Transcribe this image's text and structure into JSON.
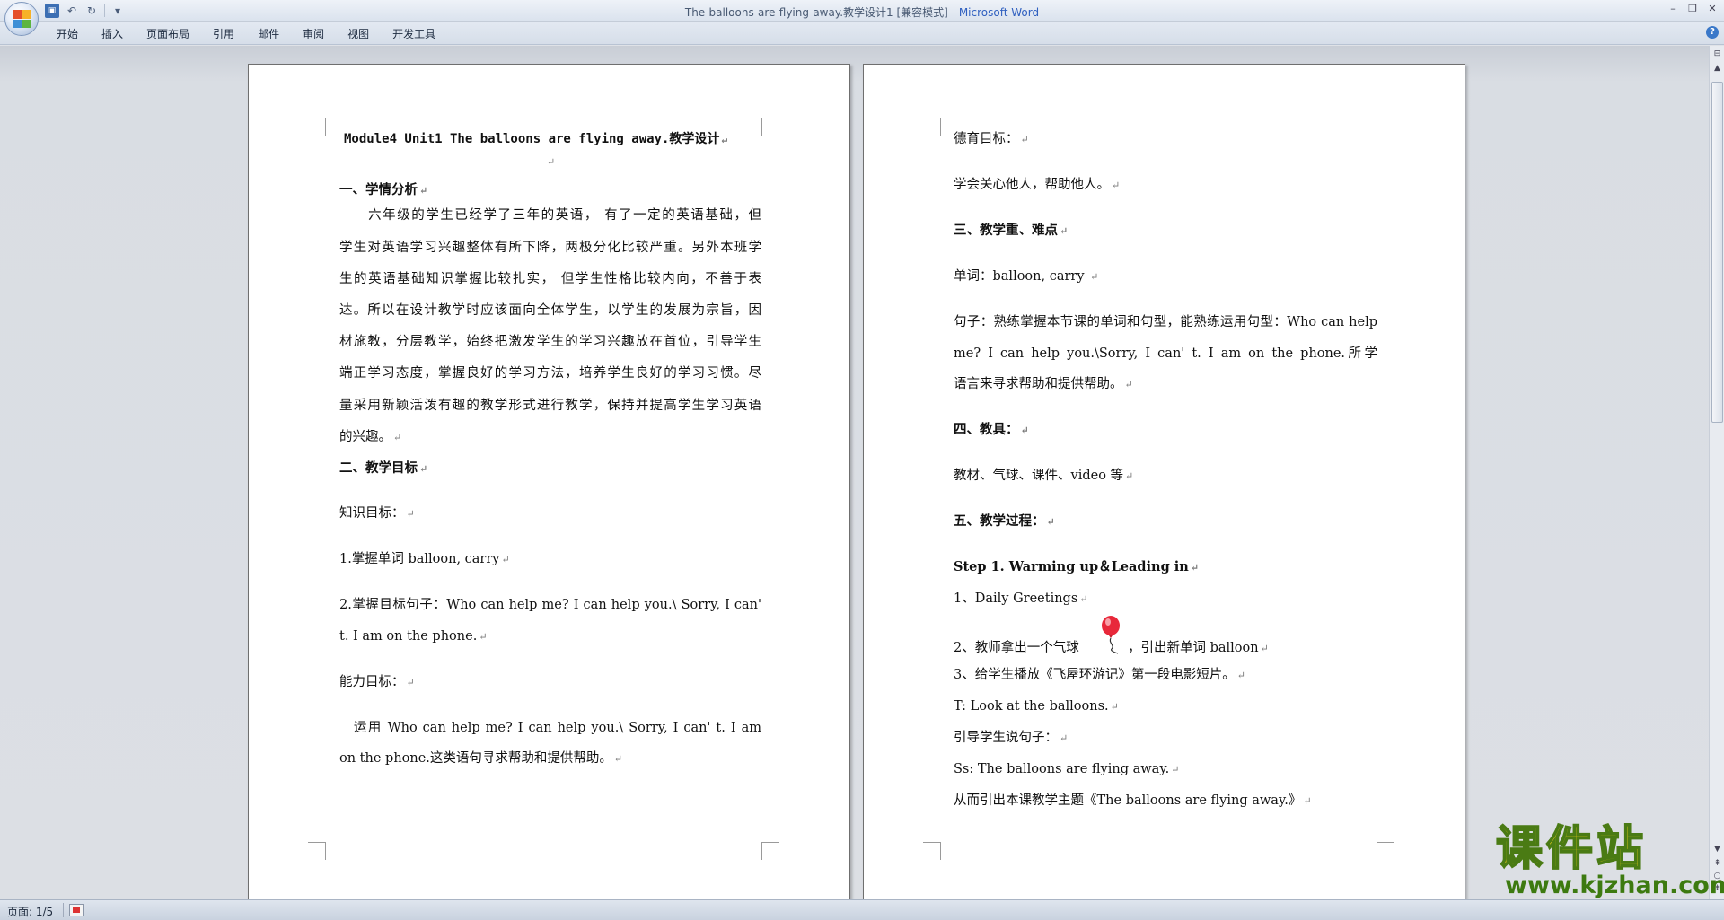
{
  "window": {
    "title_doc": "The-balloons-are-flying-away.教学设计1 [兼容模式]",
    "title_sep": " - ",
    "title_app": "Microsoft Word"
  },
  "ribbon": {
    "tabs": [
      "开始",
      "插入",
      "页面布局",
      "引用",
      "邮件",
      "审阅",
      "视图",
      "开发工具"
    ]
  },
  "status": {
    "page": "页面: 1/5"
  },
  "page1": {
    "title": "Module4 Unit1 The balloons are flying away.教学设计",
    "h1": "一、学情分析",
    "para1": [
      "　　六年级的学生已经学了三年的英语， 有了一定的英语基础，但",
      "学生对英语学习兴趣整体有所下降，两极分化比较严重。另外本班学",
      "生的英语基础知识掌握比较扎实， 但学生性格比较内向，不善于表",
      "达。所以在设计教学时应该面向全体学生，以学生的发展为宗旨，因",
      "材施教，分层教学，始终把激发学生的学习兴趣放在首位，引导学生",
      "端正学习态度，掌握良好的学习方法，培养学生良好的学习习惯。尽",
      "量采用新颖活泼有趣的教学形式进行教学，保持并提高学生学习英语",
      "的兴趣。"
    ],
    "h2": "二、教学目标",
    "knowledge_label": "知识目标：",
    "k1": "1.掌握单词 balloon, carry",
    "k2_line1": "2.掌握目标句子：Who can help me? I can help you.\\ Sorry, I can'",
    "k2_line2": "t. I am on the phone.",
    "ability_label": "能力目标：",
    "a1_line1": "　运用 Who can help me? I can help you.\\ Sorry, I can' t. I am",
    "a1_line2": "on the phone.这类语句寻求帮助和提供帮助。"
  },
  "page2": {
    "moral_label": "德育目标：",
    "moral_text": "学会关心他人，帮助他人。",
    "h3": "三、教学重、难点",
    "words": "单词：balloon, carry ",
    "sent_line1": "句子：熟练掌握本节课的单词和句型，能熟练运用句型：Who can help",
    "sent_line2": "me? I can help you.\\Sorry, I can' t. I am on the phone.所学",
    "sent_line3": "语言来寻求帮助和提供帮助。",
    "h4": "四、教具：",
    "tools": "教材、气球、课件、video 等",
    "h5": "五、教学过程：",
    "step1": "Step 1. Warming up＆Leading in",
    "s1": "1、Daily Greetings",
    "s2a": "2、教师拿出一个气球",
    "s2b": "，引出新单词 balloon",
    "s3": "3、给学生播放《飞屋环游记》第一段电影短片。",
    "t_line": "T: Look at the balloons.",
    "guide": "引导学生说句子：",
    "ss_line": "Ss: The balloons are flying away.",
    "topic": "从而引出本课教学主题《The balloons are flying away.》"
  },
  "watermark": {
    "cn": "课件站",
    "url": "www.kjzhan.com"
  },
  "marks": {
    "para": "↵"
  }
}
